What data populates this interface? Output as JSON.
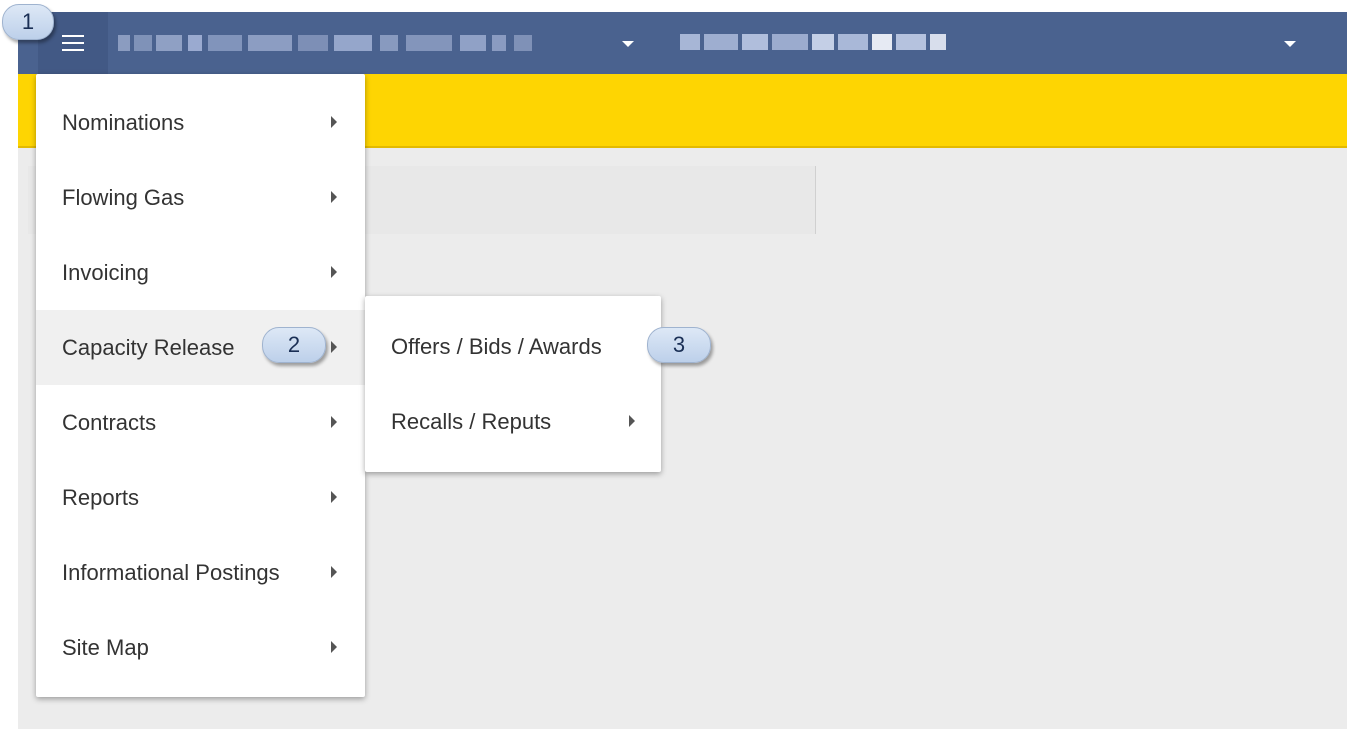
{
  "topbar": {
    "menu_button_icon": "hamburger-icon",
    "dropdown_1_caret_icon": "caret-down-icon",
    "dropdown_2_caret_icon": "caret-down-icon"
  },
  "colors": {
    "topbar": "#4a628f",
    "banner": "#fed502",
    "callout": "#c9d9ef"
  },
  "main_menu": {
    "items": [
      {
        "label": "Nominations"
      },
      {
        "label": "Flowing Gas"
      },
      {
        "label": "Invoicing"
      },
      {
        "label": "Capacity Release",
        "active": true
      },
      {
        "label": "Contracts"
      },
      {
        "label": "Reports"
      },
      {
        "label": "Informational Postings"
      },
      {
        "label": "Site Map"
      }
    ]
  },
  "submenu": {
    "items": [
      {
        "label": "Offers / Bids / Awards"
      },
      {
        "label": "Recalls / Reputs"
      }
    ]
  },
  "callouts": [
    "1",
    "2",
    "3"
  ]
}
